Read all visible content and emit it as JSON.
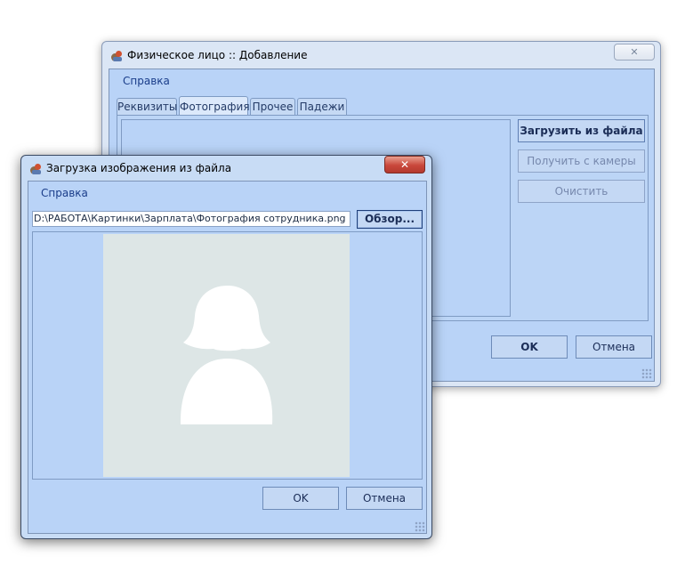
{
  "back_window": {
    "title": "Физическое лицо :: Добавление",
    "menu": "Справка",
    "tabs": [
      "Реквизиты",
      "Фотография",
      "Прочее",
      "Падежи"
    ],
    "buttons": {
      "load_file": "Загрузить из файла",
      "from_camera": "Получить с камеры",
      "clear": "Очистить",
      "ok": "OK",
      "cancel": "Отмена"
    },
    "close_glyph": "✕"
  },
  "front_window": {
    "title": "Загрузка изображения из файла",
    "menu": "Справка",
    "file_path": "D:\\РАБОТА\\Картинки\\Зарплата\\Фотография сотрудника.png",
    "browse_label": "Обзор...",
    "ok": "OK",
    "cancel": "Отмена",
    "close_glyph": "✕"
  },
  "colors": {
    "client_blue": "#b9d3f7",
    "photo_bg": "#dde6e6",
    "close_red": "#c9473b"
  }
}
